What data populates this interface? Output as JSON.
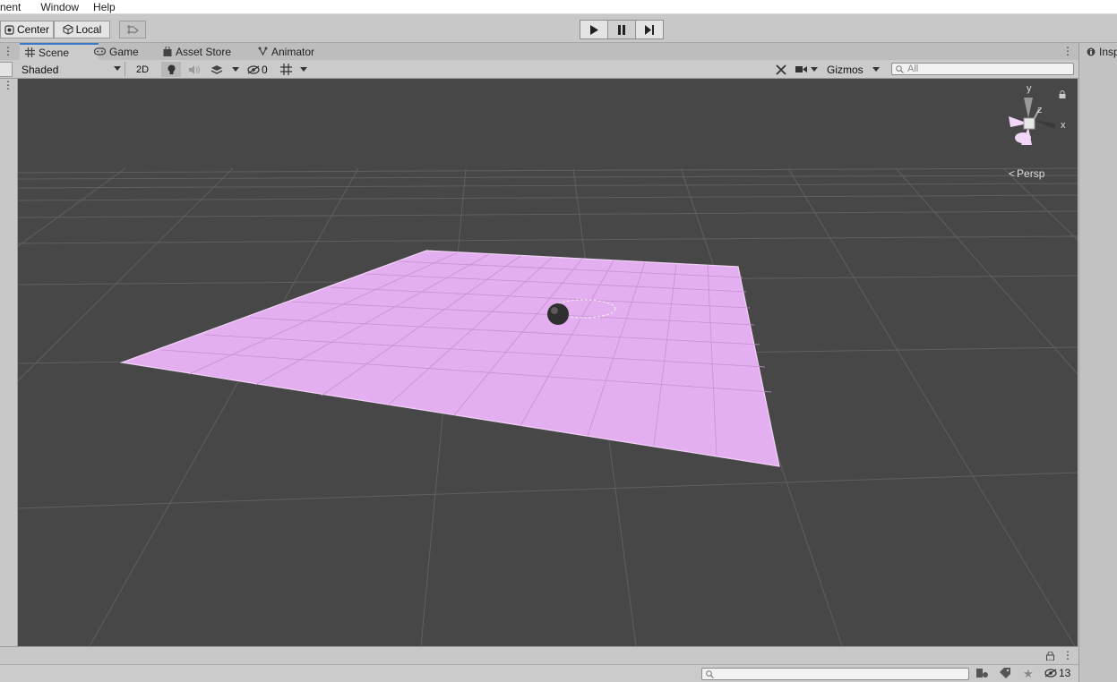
{
  "menubar": {
    "items": [
      "nent",
      "Window",
      "Help"
    ]
  },
  "main_toolbar": {
    "pivot_label": "Center",
    "space_label": "Local"
  },
  "tabs": [
    {
      "label": "Scene",
      "icon": "grid-icon"
    },
    {
      "label": "Game",
      "icon": "gamepad-icon"
    },
    {
      "label": "Asset Store",
      "icon": "bag-icon"
    },
    {
      "label": "Animator",
      "icon": "animator-icon"
    }
  ],
  "inspector_tab": {
    "label": "Insp"
  },
  "scene_toolbar": {
    "shading_mode": "Shaded",
    "mode_2d": "2D",
    "hidden_count": "0",
    "gizmos_label": "Gizmos",
    "search_placeholder": "All"
  },
  "gizmo": {
    "y_label": "y",
    "z_label": "z",
    "x_label": "x",
    "projection_label": "Persp"
  },
  "bottom_bar": {
    "hidden_objects_count": "13"
  },
  "colors": {
    "plane": "#e9b7f4",
    "viewport_bg": "#474747",
    "grid": "#5c5c5c",
    "accent": "#3a79c8"
  }
}
